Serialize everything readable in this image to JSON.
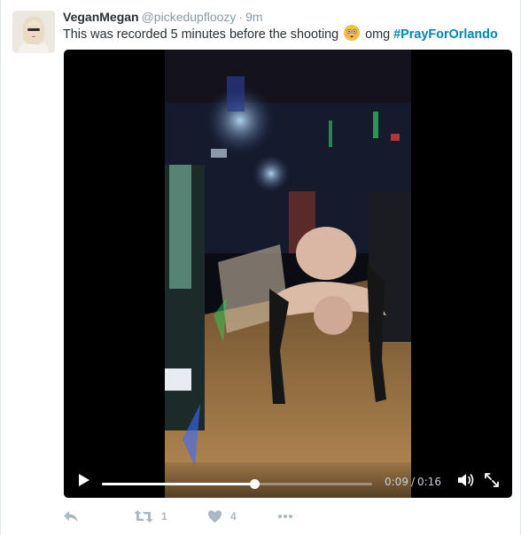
{
  "tweet": {
    "display_name": "VeganMegan",
    "screen_name": "@pickedupfloozy",
    "separator": "·",
    "timestamp": "9m",
    "text_before": "This was recorded 5 minutes before the shooting",
    "emoji": "flushed-face",
    "text_after": "omg",
    "hashtag": "#PrayForOrlando"
  },
  "video": {
    "current_time": "0:09",
    "time_separator": "/",
    "duration": "0:16",
    "progress_fraction": 0.5625
  },
  "actions": {
    "retweet_count": "1",
    "like_count": "4"
  },
  "colors": {
    "name": "#292f33",
    "meta": "#8899a6",
    "hashtag": "#0084b4",
    "action_icon": "#aab8c2"
  }
}
